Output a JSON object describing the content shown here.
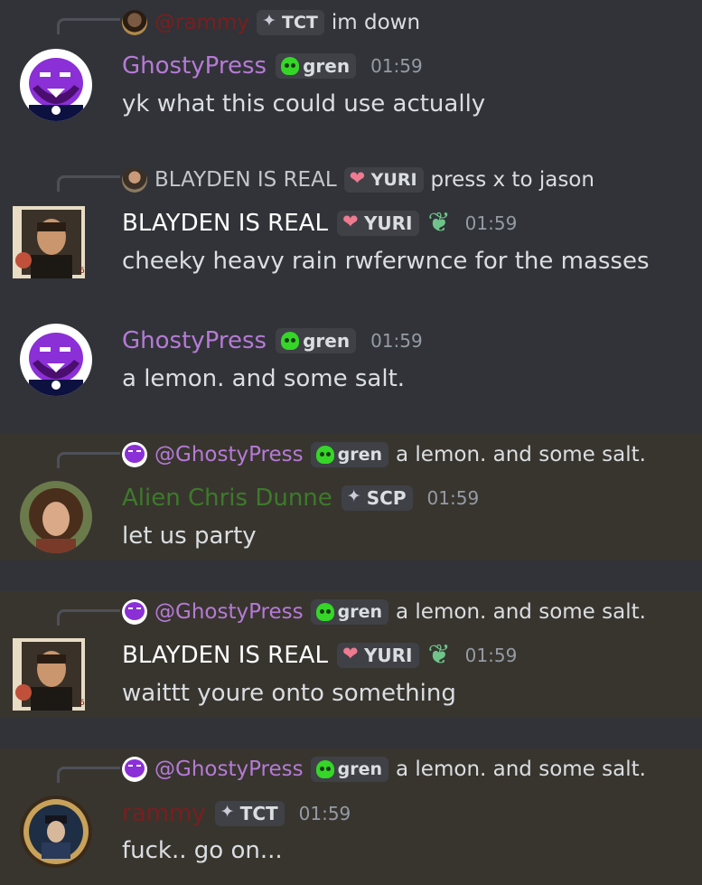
{
  "messages": [
    {
      "reply": {
        "name": "@rammy",
        "tag": "TCT",
        "text": "im down"
      },
      "author": "GhostyPress",
      "tag": "gren",
      "time": "01:59",
      "content": "yk what this could use actually"
    },
    {
      "reply": {
        "name": "BLAYDEN IS REAL",
        "tag": "YURI",
        "text": "press x to jason"
      },
      "author": "BLAYDEN IS REAL",
      "tag": "YURI",
      "time": "01:59",
      "content": "cheeky heavy rain rwferwnce for the masses"
    },
    {
      "author": "GhostyPress",
      "tag": "gren",
      "time": "01:59",
      "content": "a lemon. and some salt."
    },
    {
      "reply": {
        "name": "@GhostyPress",
        "tag": "gren",
        "text": "a lemon. and some salt."
      },
      "author": "Alien Chris Dunne",
      "tag": "SCP",
      "time": "01:59",
      "content": "let us party"
    },
    {
      "reply": {
        "name": "@GhostyPress",
        "tag": "gren",
        "text": "a lemon. and some salt."
      },
      "author": "BLAYDEN IS REAL",
      "tag": "YURI",
      "time": "01:59",
      "content": "waittt youre onto something"
    },
    {
      "reply": {
        "name": "@GhostyPress",
        "tag": "gren",
        "text": "a lemon. and some salt."
      },
      "author": "rammy",
      "tag": "TCT",
      "time": "01:59",
      "content": "fuck.. go on..."
    }
  ],
  "colors": {
    "background": "#313338",
    "mention_highlight": "#38352f",
    "ghostypress": "#b67ad6",
    "rammy": "#7a1e1e",
    "blayden": "#ffffff",
    "alien": "#3d7a2a",
    "timestamp": "#949ba4"
  },
  "icons": {
    "gren_tag": "green-skull-icon",
    "yuri_tag": "pink-heart-icon",
    "tct_tag": "diamond-icon",
    "scp_tag": "diamond-icon",
    "blayden_extra": "leaf-badge-icon"
  }
}
